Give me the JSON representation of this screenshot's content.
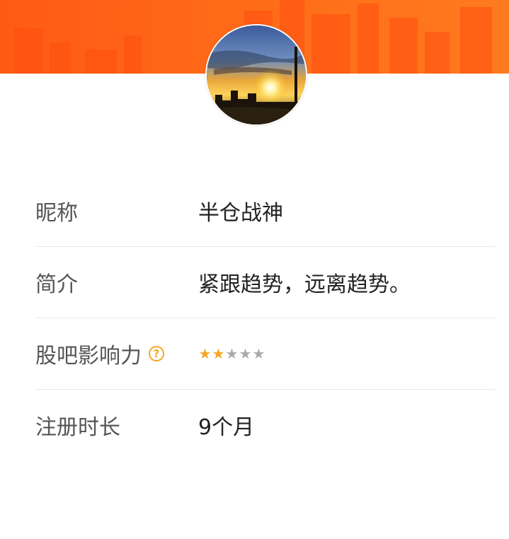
{
  "profile": {
    "avatar_icon": "sunset-city-avatar",
    "accent_color": "#ff6a18",
    "rows": [
      {
        "label": "昵称",
        "value": "半仓战神"
      },
      {
        "label": "简介",
        "value": "紧跟趋势，远离趋势。"
      },
      {
        "label": "股吧影响力",
        "help_glyph": "?",
        "rating": 2,
        "rating_max": 5
      },
      {
        "label": "注册时长",
        "value": "9个月"
      }
    ]
  }
}
